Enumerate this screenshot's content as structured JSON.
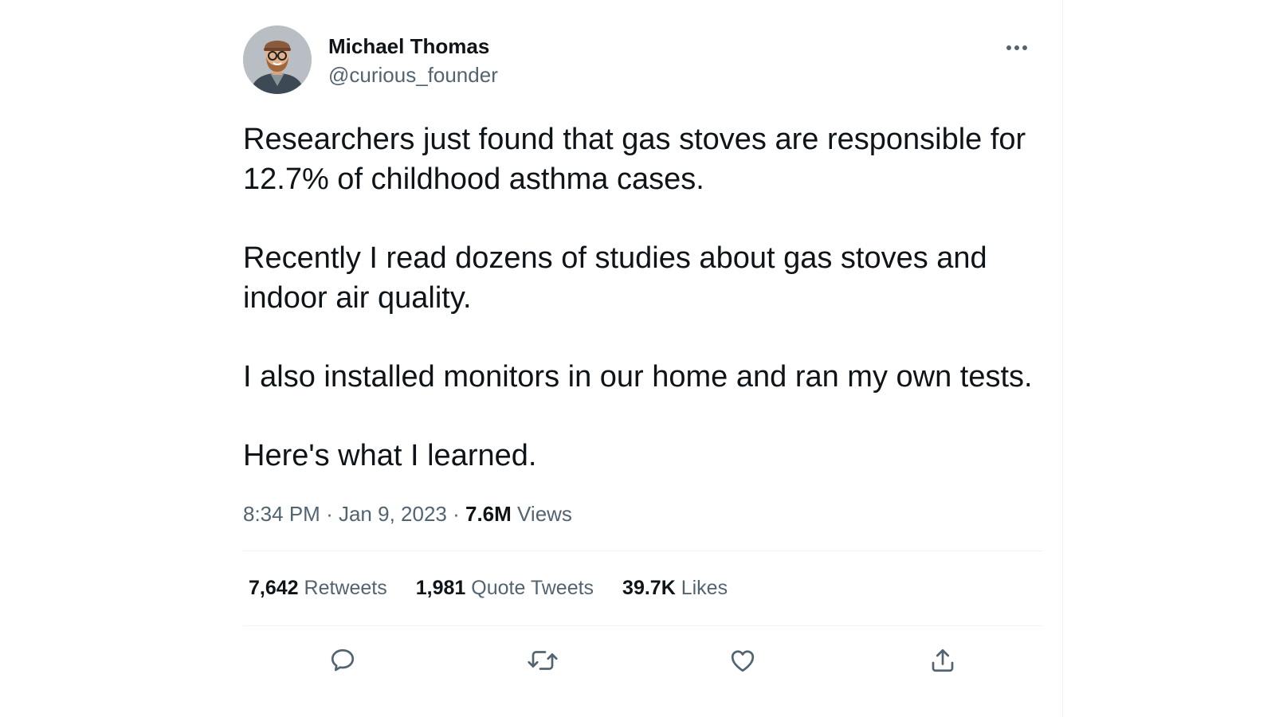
{
  "author": {
    "display_name": "Michael Thomas",
    "handle": "@curious_founder",
    "avatar_icon": "avatar-photo"
  },
  "header": {
    "more_icon": "more-horizontal-icon"
  },
  "tweet": {
    "paragraphs": [
      "Researchers just found that gas stoves are responsible for 12.7% of childhood asthma cases.",
      "Recently I read dozens of studies about gas stoves and indoor air quality.",
      "I also installed monitors in our home and ran my own tests.",
      "Here's what I learned."
    ],
    "time": "8:34 PM",
    "separator": "·",
    "date": "Jan 9, 2023",
    "views_count": "7.6M",
    "views_label": "Views"
  },
  "stats": {
    "retweets_count": "7,642",
    "retweets_label": "Retweets",
    "quotes_count": "1,981",
    "quotes_label": "Quote Tweets",
    "likes_count": "39.7K",
    "likes_label": "Likes"
  },
  "actions": {
    "reply_icon": "reply-icon",
    "retweet_icon": "retweet-icon",
    "like_icon": "like-icon",
    "share_icon": "share-icon"
  },
  "colors": {
    "text_primary": "#0f1419",
    "text_secondary": "#536471",
    "divider": "#eff3f4"
  }
}
